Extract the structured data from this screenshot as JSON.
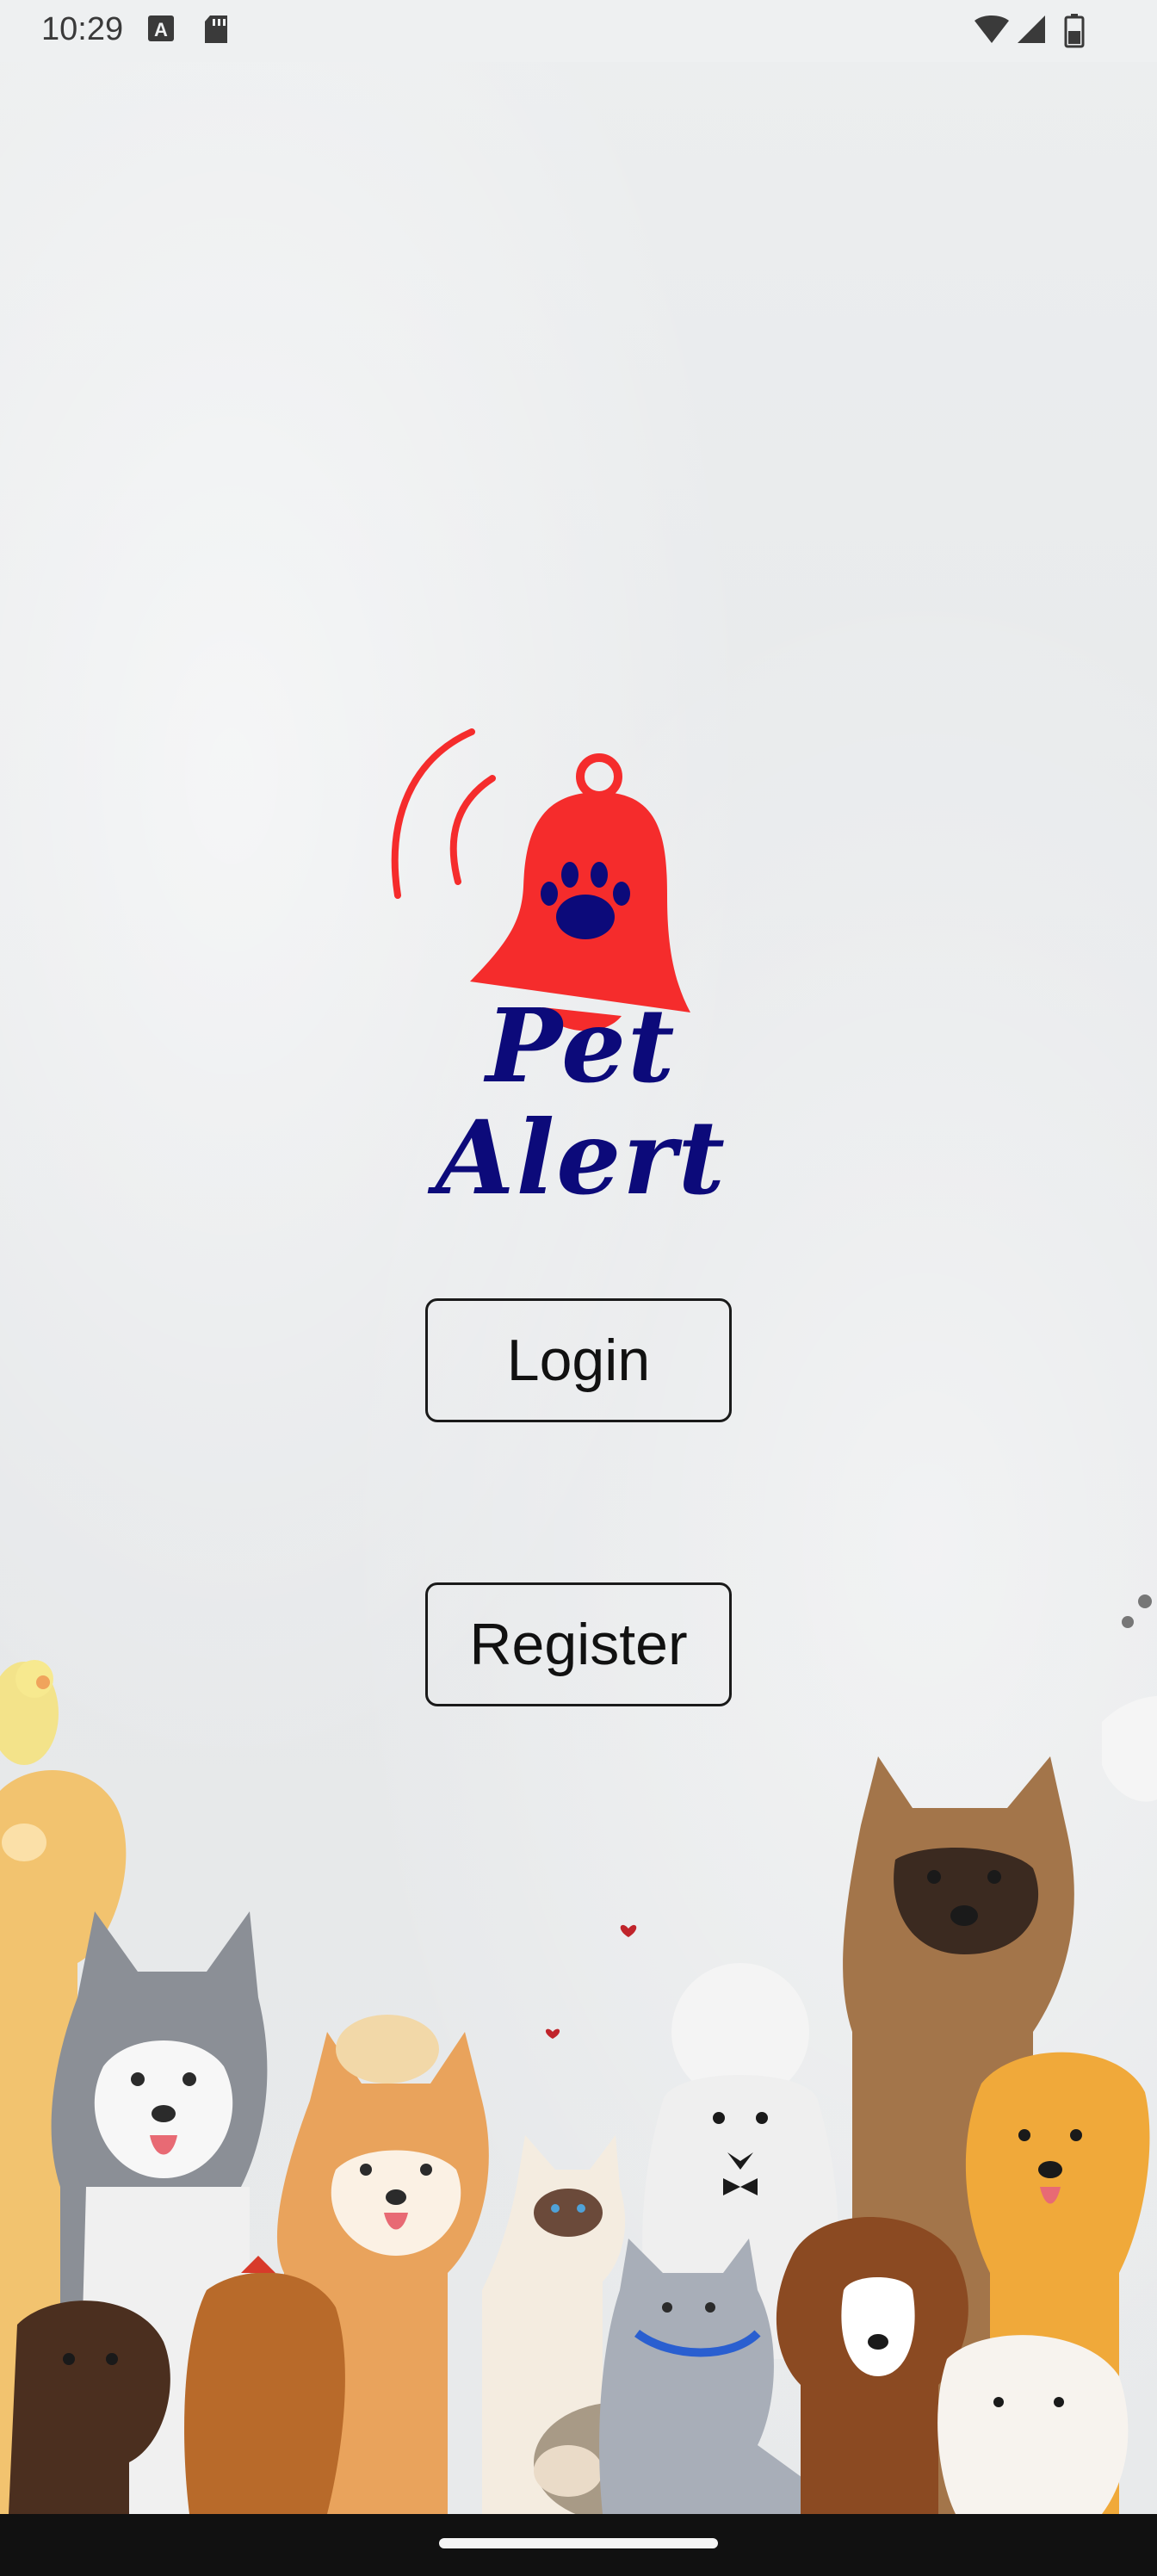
{
  "status_bar": {
    "time": "10:29",
    "left_icons": [
      "a-notification-icon",
      "sd-card-icon"
    ],
    "right_icons": [
      "wifi-icon",
      "cell-signal-icon",
      "battery-icon"
    ]
  },
  "logo": {
    "text": "Pet Alert",
    "bell_color": "#f52c2c",
    "text_color": "#0c0a7a"
  },
  "actions": {
    "login_label": "Login",
    "register_label": "Register"
  },
  "illustration": {
    "subject": "group of watercolor dogs and cats"
  }
}
